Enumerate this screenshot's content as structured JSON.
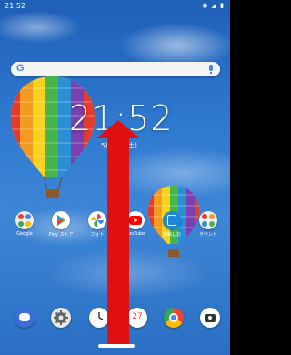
{
  "status_bar": {
    "time": "21:52",
    "icons": "wifi signal battery"
  },
  "search": {
    "g_letter": "G"
  },
  "lock_clock": {
    "time": "21:52",
    "date": "5月 1日 (土)"
  },
  "apps": [
    {
      "label": "Google"
    },
    {
      "label": "Play ストア"
    },
    {
      "label": "フォト"
    },
    {
      "label": "YouTube"
    },
    {
      "label": "楽曲しお"
    },
    {
      "label": "サウンド"
    }
  ],
  "dock": [
    {
      "name": "messages"
    },
    {
      "name": "settings"
    },
    {
      "name": "clock"
    },
    {
      "name": "calendar",
      "day": "27"
    },
    {
      "name": "chrome"
    },
    {
      "name": "camera"
    }
  ],
  "accent": {
    "arrow": "#e01010",
    "sky": "#2f79d0"
  }
}
